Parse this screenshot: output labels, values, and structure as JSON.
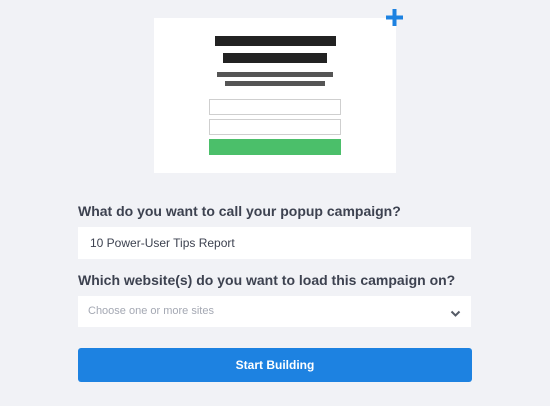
{
  "preview": {
    "add_icon": "plus-icon",
    "add_icon_color": "#1d82e1",
    "button_color": "#4bbf6a"
  },
  "form": {
    "campaign_name_label": "What do you want to call your popup campaign?",
    "campaign_name_value": "10 Power-User Tips Report",
    "websites_label": "Which website(s) do you want to load this campaign on?",
    "websites_placeholder": "Choose one or more sites",
    "websites_icon": "chevron-down-icon",
    "submit_label": "Start Building",
    "submit_color": "#1d82e1"
  }
}
